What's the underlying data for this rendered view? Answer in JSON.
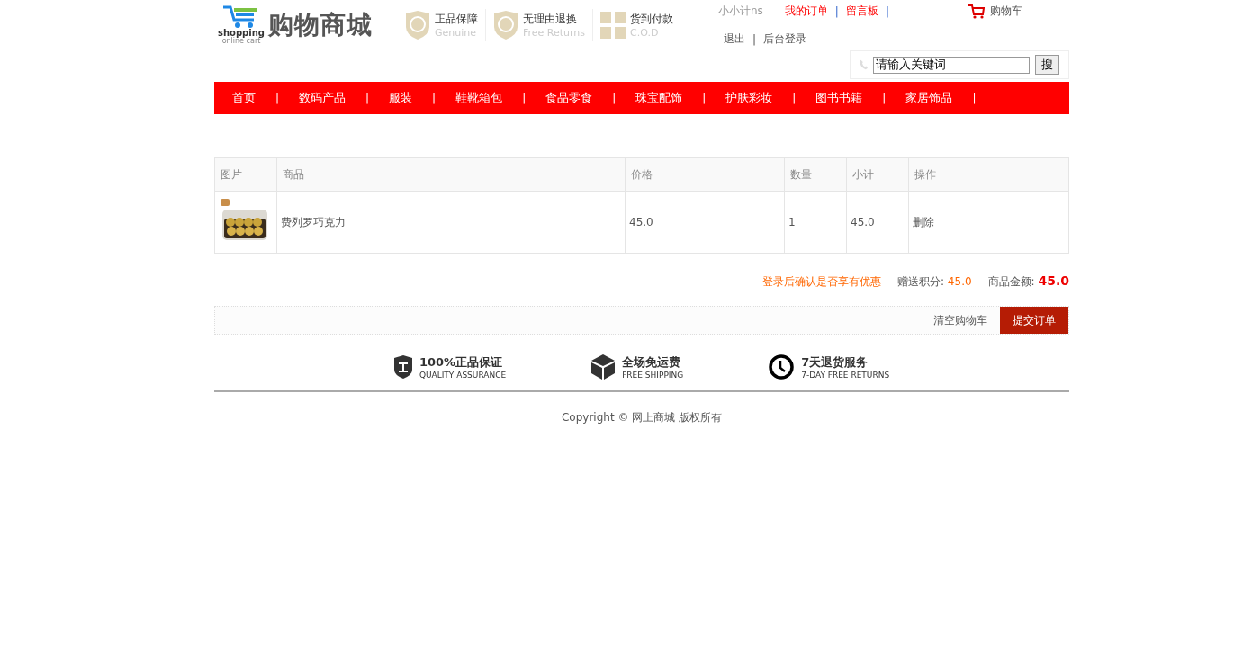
{
  "logo": {
    "title": "购物商城",
    "caption": "shopping",
    "tagline": "online cart"
  },
  "badges": [
    {
      "title": "正品保障",
      "subtitle": "Genuine",
      "kind": "shield"
    },
    {
      "title": "无理由退换",
      "subtitle": "Free Returns",
      "kind": "shield"
    },
    {
      "title": "货到付款",
      "subtitle": "C.O.D",
      "kind": "gift"
    }
  ],
  "user_bar": {
    "greeting": "小小计ns",
    "links": [
      "我的订单",
      "留言板"
    ],
    "separator": "|",
    "cart": "购物车",
    "account_links": [
      "退出",
      "后台登录"
    ]
  },
  "search": {
    "value": "请输入关键词",
    "button": "搜"
  },
  "nav": {
    "separator": "|",
    "items": [
      "首页",
      "数码产品",
      "服装",
      "鞋靴箱包",
      "食品零食",
      "珠宝配饰",
      "护肤彩妆",
      "图书书籍",
      "家居饰品"
    ]
  },
  "table": {
    "columns": [
      "图片",
      "商品",
      "价格",
      "数量",
      "小计",
      "操作"
    ],
    "rows": [
      {
        "name": "费列罗巧克力",
        "price": "45.0",
        "quantity": "1",
        "subtotal": "45.0",
        "action": "删除"
      }
    ]
  },
  "summary": {
    "notice": "登录后确认是否享有优惠",
    "points_label": "赠送积分:",
    "points": "45.0",
    "total_label": "商品金额:",
    "total": "45.0"
  },
  "actions": {
    "clear": "清空购物车",
    "submit": "提交订单"
  },
  "features": [
    {
      "title": "100%正品保证",
      "subtitle": "QUALITY ASSURANCE",
      "kind": "shield"
    },
    {
      "title": "全场免运费",
      "subtitle": "FREE SHIPPING",
      "kind": "box"
    },
    {
      "title": "7天退货服务",
      "subtitle": "7-DAY FREE RETURNS",
      "kind": "clock"
    }
  ],
  "copyright": "Copyright © 网上商城 版权所有"
}
